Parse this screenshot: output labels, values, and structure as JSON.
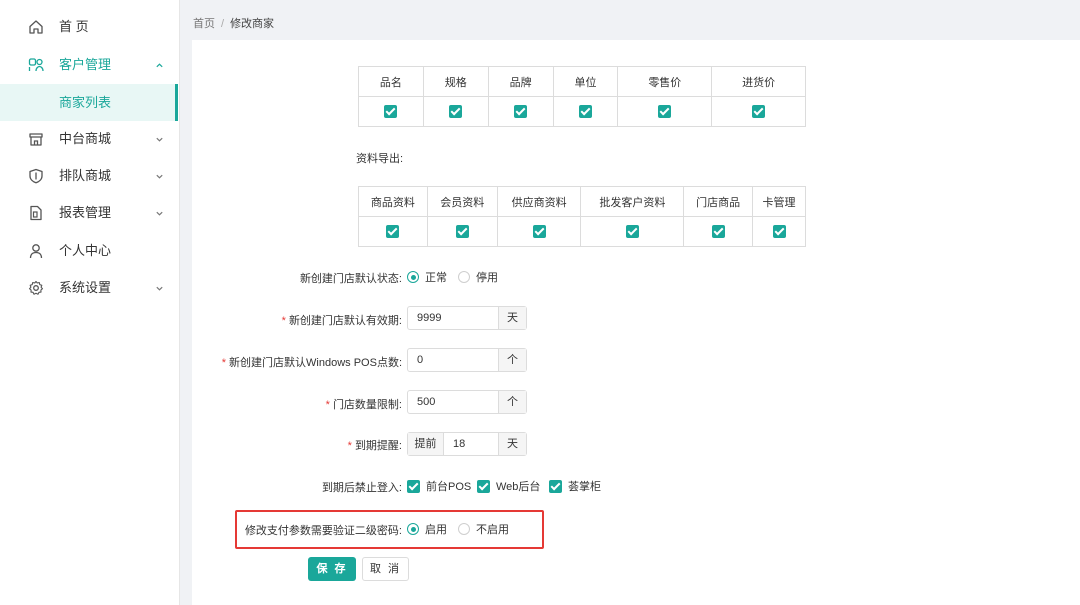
{
  "sidebar": {
    "items": [
      {
        "label": "首 页",
        "icon": "home-icon"
      },
      {
        "label": "客户管理",
        "icon": "customer-icon",
        "expanded": true
      },
      {
        "label": "中台商城",
        "icon": "store-icon"
      },
      {
        "label": "排队商城",
        "icon": "shield-icon"
      },
      {
        "label": "报表管理",
        "icon": "report-icon"
      },
      {
        "label": "个人中心",
        "icon": "user-icon"
      },
      {
        "label": "系统设置",
        "icon": "gear-icon"
      }
    ],
    "sub_item": {
      "label": "商家列表"
    }
  },
  "breadcrumb": {
    "home": "首页",
    "separator": "/",
    "current": "修改商家"
  },
  "product_fields": {
    "headers": [
      "品名",
      "规格",
      "品牌",
      "单位",
      "零售价",
      "进货价"
    ],
    "checked": [
      true,
      true,
      true,
      true,
      true,
      true
    ]
  },
  "export": {
    "label": "资料导出:",
    "headers": [
      "商品资料",
      "会员资料",
      "供应商资料",
      "批发客户资料",
      "门店商品",
      "卡管理"
    ],
    "checked": [
      true,
      true,
      true,
      true,
      true,
      true
    ]
  },
  "form": {
    "default_status": {
      "label": "新创建门店默认状态:",
      "options": [
        "正常",
        "停用"
      ],
      "selected": "正常"
    },
    "default_validity": {
      "label": "新创建门店默认有效期:",
      "value": "9999",
      "unit": "天",
      "required": true
    },
    "default_pos": {
      "label": "新创建门店默认Windows POS点数:",
      "value": "0",
      "unit": "个",
      "required": true
    },
    "store_limit": {
      "label": "门店数量限制:",
      "value": "500",
      "unit": "个",
      "required": true
    },
    "expiry_reminder": {
      "label": "到期提醒:",
      "prefix": "提前",
      "value": "18",
      "unit": "天",
      "required": true
    },
    "login_block": {
      "label": "到期后禁止登入:",
      "options": [
        "前台POS",
        "Web后台",
        "荟掌柜"
      ],
      "checked": [
        true,
        true,
        true
      ]
    },
    "payment_verify": {
      "label": "修改支付参数需要验证二级密码:",
      "options": [
        "启用",
        "不启用"
      ],
      "selected": "启用"
    }
  },
  "buttons": {
    "save": "保 存",
    "cancel": "取 消"
  },
  "colors": {
    "accent": "#1aa79a",
    "highlight": "#e53935",
    "required": "#e53935"
  }
}
